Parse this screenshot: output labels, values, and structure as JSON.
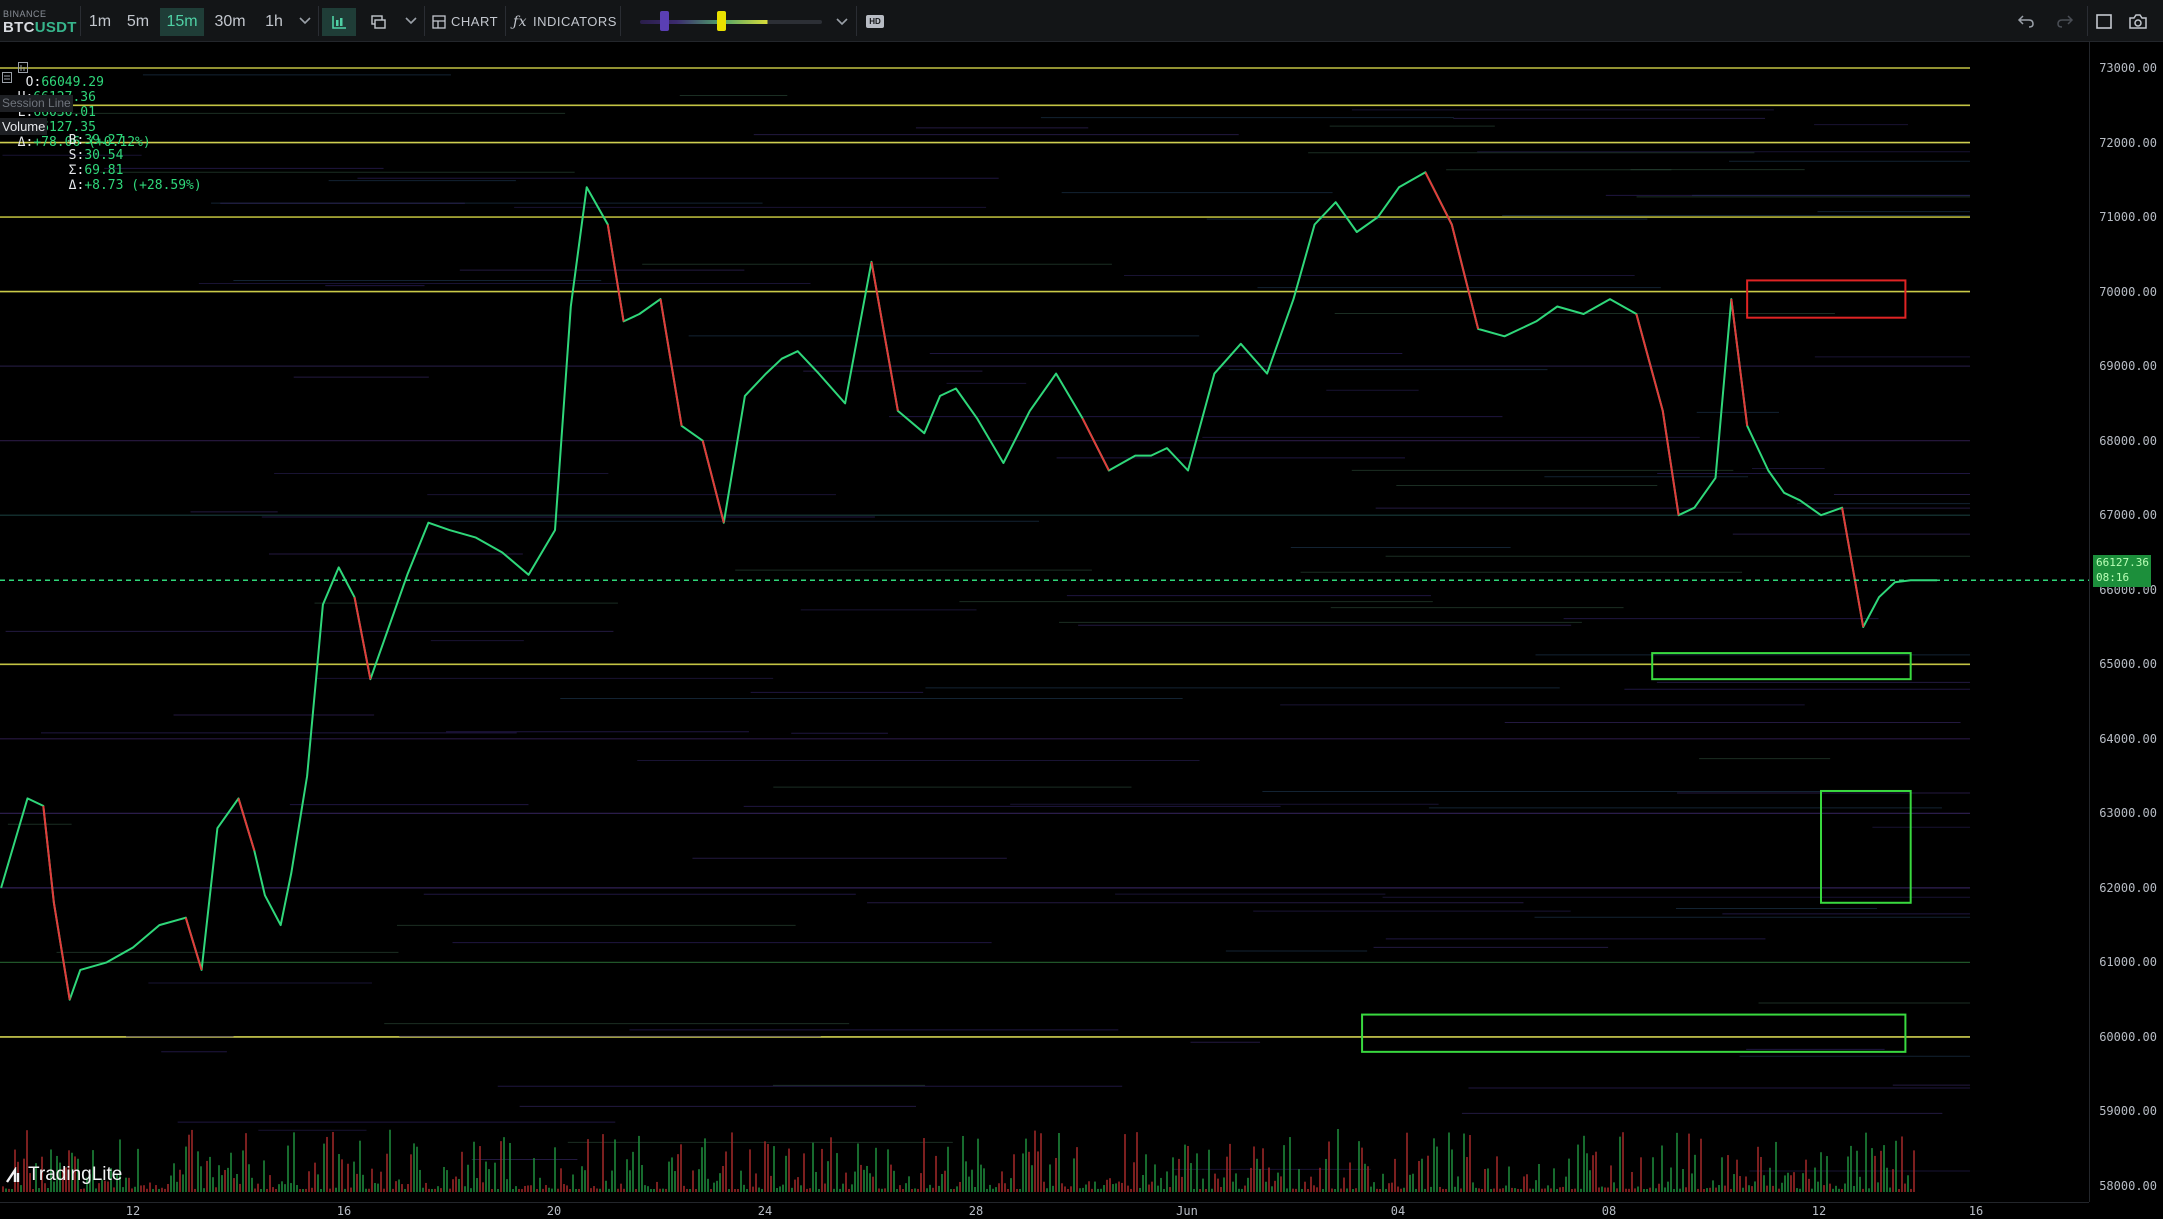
{
  "toolbar": {
    "exchange": "BINANCE",
    "pair_base": "BTC",
    "pair_quote": "USDT",
    "timeframes": [
      "1m",
      "5m",
      "15m",
      "30m",
      "1h"
    ],
    "active_timeframe": "15m",
    "chart_label": "CHART",
    "indicators_label": "INDICATORS",
    "hd_label": "HD"
  },
  "legend": {
    "o_label": "O:",
    "o": "66049.29",
    "h_label": "H:",
    "h": "66127.36",
    "l_label": "L:",
    "l": "66036.01",
    "c_label": "C:",
    "c": "66127.35",
    "d_label": "Δ:",
    "d": "+78.06 (+0.12%)",
    "session_line": "Session Line",
    "volume_label": "Volume",
    "b_label": "B:",
    "b": "39.27",
    "s_label": "S:",
    "s": "30.54",
    "sum_label": "Σ:",
    "sum": "69.81",
    "vd_label": "Δ:",
    "vd": "+8.73 (+28.59%)"
  },
  "current_price": {
    "line1": "66127.36",
    "line2": "08:16"
  },
  "logo": {
    "text": "TradingLite"
  },
  "colors": {
    "up": "#2fd77a",
    "down": "#e23b3b",
    "accent": "#4fd1a5",
    "zone_green": "#39d93f",
    "zone_red": "#e02424"
  },
  "chart_data": {
    "type": "line",
    "symbol": "BTCUSDT",
    "interval": "15m",
    "y_ticks": [
      "73000.00",
      "72000.00",
      "71000.00",
      "70000.00",
      "69000.00",
      "68000.00",
      "67000.00",
      "66000.00",
      "65000.00",
      "64000.00",
      "63000.00",
      "62000.00",
      "61000.00",
      "60000.00",
      "59000.00",
      "58000.00"
    ],
    "x_ticks": [
      "12",
      "16",
      "20",
      "24",
      "28",
      "Jun",
      "04",
      "08",
      "12",
      "16"
    ],
    "ylim": [
      57900,
      73500
    ],
    "xlim": [
      9.5,
      16.2
    ],
    "x_unit": "day index (May 9 = 9 ... Jun 16 = 47)",
    "price_series": {
      "name": "BTCUSDT",
      "x": [
        9.5,
        10.0,
        10.3,
        10.5,
        10.8,
        11.0,
        11.5,
        12.0,
        12.5,
        13.0,
        13.3,
        13.6,
        14.0,
        14.3,
        14.5,
        14.8,
        15.0,
        15.3,
        15.6,
        15.9,
        16.2,
        16.5,
        16.8,
        17.2,
        17.6,
        18.0,
        18.5,
        19.0,
        19.5,
        20.0,
        20.3,
        20.6,
        21.0,
        21.3,
        21.6,
        22.0,
        22.4,
        22.8,
        23.2,
        23.6,
        24.0,
        24.3,
        24.6,
        25.0,
        25.5,
        26.0,
        26.5,
        27.0,
        27.3,
        27.6,
        28.0,
        28.5,
        29.0,
        29.5,
        30.0,
        30.5,
        31.0,
        31.3,
        31.6,
        32.0,
        32.5,
        33.0,
        33.5,
        34.0,
        34.4,
        34.8,
        35.2,
        35.6,
        36.0,
        36.5,
        37.0,
        37.5,
        38.0,
        38.3,
        38.6,
        39.0,
        39.5,
        40.0,
        40.5,
        41.0,
        41.3,
        41.6,
        42.0,
        42.3,
        42.6,
        43.0,
        43.3,
        43.6,
        44.0,
        44.4,
        44.8,
        45.1,
        45.4,
        45.7,
        46.0,
        46.2
      ],
      "y": [
        62000,
        63200,
        63100,
        61800,
        60500,
        60900,
        61000,
        61200,
        61500,
        61600,
        60900,
        62800,
        63200,
        62500,
        61900,
        61500,
        62200,
        63500,
        65800,
        66300,
        65900,
        64800,
        65400,
        66200,
        66900,
        66800,
        66700,
        66500,
        66200,
        66800,
        69800,
        71400,
        70900,
        69600,
        69700,
        69900,
        68200,
        68000,
        66900,
        68600,
        68900,
        69100,
        69200,
        68900,
        68500,
        70400,
        68400,
        68100,
        68600,
        68700,
        68300,
        67700,
        68400,
        68900,
        68300,
        67600,
        67800,
        67800,
        67900,
        67600,
        68900,
        69300,
        68900,
        69900,
        70900,
        71200,
        70800,
        71000,
        71400,
        71600,
        70900,
        69500,
        69400,
        69500,
        69600,
        69800,
        69700,
        69900,
        69700,
        68400,
        67000,
        67100,
        67500,
        69900,
        68200,
        67600,
        67300,
        67200,
        67000,
        67100,
        65500,
        65900,
        66100,
        66127,
        66127,
        66127
      ],
      "last_close": 66127.35
    },
    "zones": [
      {
        "name": "resistance-zone",
        "price_low": 69650,
        "price_high": 70150,
        "x_start": 42.6,
        "x_end": 45.6,
        "color": "red"
      },
      {
        "name": "support-zone-65k",
        "price_low": 64800,
        "price_high": 65150,
        "x_start": 40.8,
        "x_end": 45.7,
        "color": "green"
      },
      {
        "name": "support-zone-62-63k",
        "price_low": 61800,
        "price_high": 63300,
        "x_start": 44.0,
        "x_end": 45.7,
        "color": "green"
      },
      {
        "name": "support-zone-60k",
        "price_low": 59800,
        "price_high": 60300,
        "x_start": 35.3,
        "x_end": 45.6,
        "color": "green"
      }
    ],
    "liquidity_levels": [
      {
        "price": 73000,
        "color": "#d8d84a"
      },
      {
        "price": 72500,
        "color": "#d8d84a"
      },
      {
        "price": 72000,
        "color": "#e6e65a"
      },
      {
        "price": 71000,
        "color": "#c8c840"
      },
      {
        "price": 70000,
        "color": "#e0e050"
      },
      {
        "price": 65000,
        "color": "#d8d84a"
      },
      {
        "price": 60000,
        "color": "#e6e65a"
      },
      {
        "price": 61000,
        "color": "#3a9a4a"
      },
      {
        "price": 63000,
        "color": "#5a3a9a"
      },
      {
        "price": 62000,
        "color": "#5a3a9a"
      },
      {
        "price": 64000,
        "color": "#4a2e7a"
      },
      {
        "price": 67000,
        "color": "#2e6e6a"
      },
      {
        "price": 68000,
        "color": "#4a2e7a"
      },
      {
        "price": 69000,
        "color": "#3a2e6a"
      }
    ]
  }
}
